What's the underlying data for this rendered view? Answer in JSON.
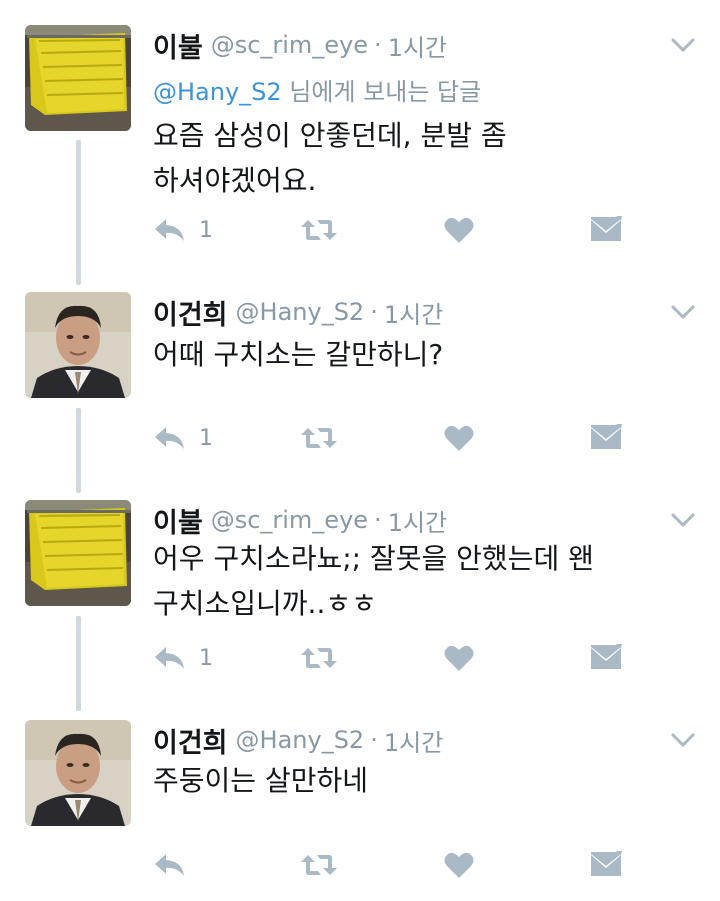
{
  "tweets": [
    {
      "user": {
        "name": "이불",
        "handle": "@sc_rim_eye",
        "avatar": "yellow-blanket-avatar"
      },
      "separator": "·",
      "time": "1시간",
      "reply_to": {
        "mention": "@Hany_S2",
        "suffix": " 님에게 보내는 답글"
      },
      "text": "요즘 삼성이 안좋던데, 분발 좀\n하셔야겠어요.",
      "reply_count": "1"
    },
    {
      "user": {
        "name": "이건희",
        "handle": "@Hany_S2",
        "avatar": "man-in-suit-avatar"
      },
      "separator": "·",
      "time": "1시간",
      "text": "어때 구치소는 갈만하니?",
      "reply_count": "1"
    },
    {
      "user": {
        "name": "이불",
        "handle": "@sc_rim_eye",
        "avatar": "yellow-blanket-avatar"
      },
      "separator": "·",
      "time": "1시간",
      "text": "어우 구치소라뇨;; 잘못을 안했는데 왠\n구치소입니까..ㅎㅎ",
      "reply_count": "1"
    },
    {
      "user": {
        "name": "이건희",
        "handle": "@Hany_S2",
        "avatar": "man-in-suit-avatar"
      },
      "separator": "·",
      "time": "1시간",
      "text": "주둥이는 살만하네",
      "reply_count": ""
    }
  ],
  "icons": {
    "reply": "reply-icon",
    "retweet": "retweet-icon",
    "like": "heart-icon",
    "message": "envelope-icon",
    "more": "chevron-down-icon"
  },
  "colors": {
    "text": "#14171a",
    "secondary": "#8899a6",
    "link": "#3b94d9",
    "icon": "#a9bac6",
    "thread_line": "#cfd8de"
  }
}
